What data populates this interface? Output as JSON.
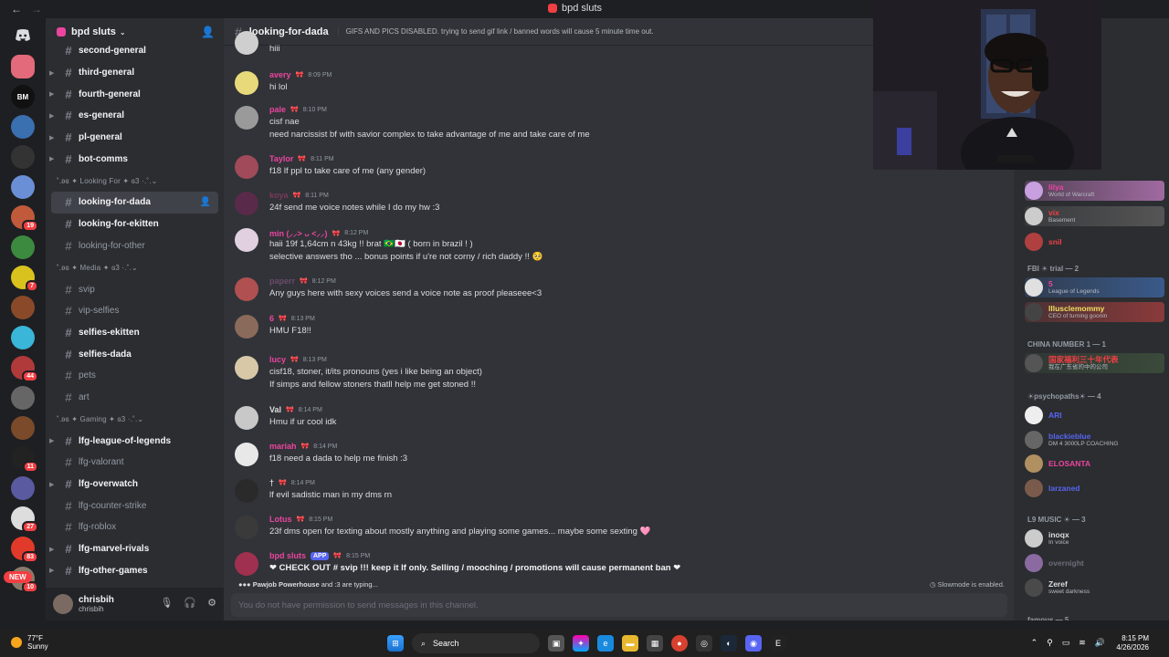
{
  "window": {
    "title": "bpd sluts",
    "back_icon": "←",
    "forward_icon": "→"
  },
  "servers": {
    "items": [
      {
        "color": "#e26a7a",
        "badge": ""
      },
      {
        "color": "#111111",
        "label": "BM",
        "badge": ""
      },
      {
        "color": "#3a6fb0",
        "badge": ""
      },
      {
        "color": "#333333",
        "badge": ""
      },
      {
        "color": "#6b8fd6",
        "badge": ""
      },
      {
        "color": "#c05a3a",
        "badge": "19"
      },
      {
        "color": "#3c8a40",
        "badge": ""
      },
      {
        "color": "#d9c21e",
        "badge": "7"
      },
      {
        "color": "#8a4a2a",
        "badge": ""
      },
      {
        "color": "#39b6d8",
        "badge": ""
      },
      {
        "color": "#b03a3a",
        "badge": "44"
      },
      {
        "color": "#666666",
        "badge": ""
      },
      {
        "color": "#7a4a2a",
        "badge": ""
      },
      {
        "color": "#222222",
        "badge": "11"
      },
      {
        "color": "#5a5aa0",
        "badge": ""
      },
      {
        "color": "#dddddd",
        "badge": "27"
      },
      {
        "color": "#e23a2a",
        "badge": "83"
      },
      {
        "color": "#8a7a6a",
        "badge": "10"
      }
    ],
    "new_label": "NEW"
  },
  "guild": {
    "name": "bpd sluts"
  },
  "channels": [
    {
      "type": "channel",
      "name": "second-general",
      "style": "bold",
      "caret": false
    },
    {
      "type": "channel",
      "name": "third-general",
      "style": "bold",
      "caret": true
    },
    {
      "type": "channel",
      "name": "fourth-general",
      "style": "bold",
      "caret": true
    },
    {
      "type": "channel",
      "name": "es-general",
      "style": "bold",
      "caret": true
    },
    {
      "type": "channel",
      "name": "pl-general",
      "style": "bold",
      "caret": true
    },
    {
      "type": "channel",
      "name": "bot-comms",
      "style": "bold",
      "caret": true
    },
    {
      "type": "category",
      "name": "˚.ʚɞ ✦ Looking For ✦ ɞ3 ·.˚."
    },
    {
      "type": "channel",
      "name": "looking-for-dada",
      "style": "active",
      "caret": false
    },
    {
      "type": "channel",
      "name": "looking-for-ekitten",
      "style": "bold",
      "caret": false
    },
    {
      "type": "channel",
      "name": "looking-for-other",
      "style": "dim",
      "caret": false
    },
    {
      "type": "category",
      "name": "˚.ʚɞ ✦ Media ✦ ɞ3 ·.˚."
    },
    {
      "type": "channel",
      "name": "svip",
      "style": "dim",
      "caret": false
    },
    {
      "type": "channel",
      "name": "vip-selfies",
      "style": "dim",
      "caret": false
    },
    {
      "type": "channel",
      "name": "selfies-ekitten",
      "style": "bold",
      "caret": false
    },
    {
      "type": "channel",
      "name": "selfies-dada",
      "style": "bold",
      "caret": false
    },
    {
      "type": "channel",
      "name": "pets",
      "style": "dim",
      "caret": false
    },
    {
      "type": "channel",
      "name": "art",
      "style": "dim",
      "caret": false
    },
    {
      "type": "category",
      "name": "˚.ʚɞ ✦ Gaming ✦ ɞ3 ·.˚."
    },
    {
      "type": "channel",
      "name": "lfg-league-of-legends",
      "style": "bold",
      "caret": true
    },
    {
      "type": "channel",
      "name": "lfg-valorant",
      "style": "dim",
      "caret": false
    },
    {
      "type": "channel",
      "name": "lfg-overwatch",
      "style": "bold",
      "caret": true
    },
    {
      "type": "channel",
      "name": "lfg-counter-strike",
      "style": "dim",
      "caret": false
    },
    {
      "type": "channel",
      "name": "lfg-roblox",
      "style": "dim",
      "caret": false
    },
    {
      "type": "channel",
      "name": "lfg-marvel-rivals",
      "style": "bold",
      "caret": true
    },
    {
      "type": "channel",
      "name": "lfg-other-games",
      "style": "bold",
      "caret": true
    }
  ],
  "user": {
    "name": "chrisbih",
    "tag": "chrisbih"
  },
  "channel_header": {
    "name": "looking-for-dada",
    "topic": "GIFS AND PICS DISABLED. trying to send gif link / banned words will cause 5 minute time out."
  },
  "messages": [
    {
      "author": "",
      "color": "#dbdee1",
      "time": "",
      "lines": [
        "hiii"
      ],
      "avatar": "#cfcfcf"
    },
    {
      "author": "avery",
      "color": "#eb459f",
      "time": "8:09 PM",
      "lines": [
        "hi lol"
      ],
      "avatar": "#e8d97a"
    },
    {
      "author": "pale",
      "color": "#eb459f",
      "time": "8:10 PM",
      "lines": [
        "cisf nae",
        "need narcissist bf with savior complex to take advantage of me and take care of me"
      ],
      "avatar": "#9a9a9a"
    },
    {
      "author": "Taylor",
      "color": "#eb459f",
      "time": "8:11 PM",
      "lines": [
        "f18 lf ppl to take care of me (any gender)"
      ],
      "avatar": "#a04a5a"
    },
    {
      "author": "koya",
      "color": "#7a3a5a",
      "time": "8:11 PM",
      "lines": [
        "24f send me voice notes while I do my hw :3"
      ],
      "avatar": "#5a2a4a"
    },
    {
      "author": "min (⸝⸝> ᴗ <⸝⸝)",
      "color": "#eb459f",
      "time": "8:12 PM",
      "lines": [
        "haii 19f 1,64cm n 43kg !! brat 🇧🇷🇯🇵 ( born in brazil ! )",
        "selective answers tho ... bonus points if u're not corny / rich daddy !! 🥺"
      ],
      "avatar": "#e0d0e0"
    },
    {
      "author": "paperr",
      "color": "#6a4a6a",
      "time": "8:12 PM",
      "lines": [
        "Any guys here with sexy voices send a voice note as proof pleaseee<3"
      ],
      "avatar": "#b05050"
    },
    {
      "author": "6",
      "color": "#eb459f",
      "time": "8:13 PM",
      "lines": [
        "HMU F18!!"
      ],
      "avatar": "#8a6a5a"
    },
    {
      "author": "lucy",
      "color": "#eb459f",
      "time": "8:13 PM",
      "lines": [
        "cisf18, stoner, it/its pronouns (yes i like being an object)",
        "If simps and fellow stoners thatll help me get stoned !!"
      ],
      "avatar": "#d8c8a8"
    },
    {
      "author": "Val",
      "color": "#dbdee1",
      "time": "8:14 PM",
      "lines": [
        "Hmu if ur cool idk"
      ],
      "avatar": "#c8c8c8"
    },
    {
      "author": "mariah",
      "color": "#eb459f",
      "time": "8:14 PM",
      "lines": [
        "f18 need a dada to help me finish :3"
      ],
      "avatar": "#e8e8e8"
    },
    {
      "author": "†",
      "color": "#dbdee1",
      "time": "8:14 PM",
      "lines": [
        "lf evil sadistic man in my dms rn"
      ],
      "avatar": "#2a2a2a"
    },
    {
      "author": "Lotus",
      "color": "#eb459f",
      "time": "8:15 PM",
      "lines": [
        "23f dms open for texting about mostly anything and playing some games... maybe some sexting 🩷"
      ],
      "avatar": "#3a3a3a"
    },
    {
      "author": "bpd sluts",
      "color": "#eb459f",
      "time": "8:15 PM",
      "app": "APP",
      "lines": [
        "❤ CHECK OUT # svip !!! keep it lf only. Selling / mooching / promotions will cause permanent ban ❤"
      ],
      "avatar": "#a03050"
    }
  ],
  "typing": {
    "who": "Pawjob Powerhouse",
    "rest": "and :3 are typing..."
  },
  "slowmode": "Slowmode is enabled.",
  "composer_placeholder": "You do not have permission to send messages in this channel.",
  "member_groups": [
    {
      "title": "",
      "members": [
        {
          "name": "lilya",
          "status": "World of Warcraft",
          "color": "#eb459f",
          "bg": "#a06aa0",
          "avatar": "#c8a0e0"
        },
        {
          "name": "vix",
          "status": "Basement",
          "color": "#f23f43",
          "bg": "#555555",
          "avatar": "#cccccc"
        },
        {
          "name": "snil",
          "status": "",
          "color": "#f23f43",
          "bg": "",
          "avatar": "#b04040"
        }
      ]
    },
    {
      "title": "FBI ☀ trial — 2",
      "members": [
        {
          "name": "5",
          "status": "League of Legends",
          "color": "#eb459f",
          "bg": "#3a5a8a",
          "avatar": "#e0e0e0"
        },
        {
          "name": "lllusclemommy",
          "status": "CEO of turning goonin",
          "color": "#f0e060",
          "bg": "#8a3a3a",
          "avatar": "#444444"
        }
      ]
    },
    {
      "title": "CHINA NUMBER 1 — 1",
      "members": [
        {
          "name": "国家福利三十年代表",
          "status": "我在广东省的中的公司",
          "color": "#f23f43",
          "bg": "#3a4a3a",
          "avatar": "#555555"
        }
      ]
    },
    {
      "title": "☀psychopaths☀ — 4",
      "members": [
        {
          "name": "ARI",
          "status": "",
          "color": "#5865f2",
          "bg": "",
          "avatar": "#eeeeee"
        },
        {
          "name": "blackieblue",
          "status": "DM 4 3000LP COACHING",
          "color": "#5865f2",
          "bg": "",
          "avatar": "#666666"
        },
        {
          "name": "ELOSANTA",
          "status": "",
          "color": "#eb459f",
          "bg": "",
          "avatar": "#b09060"
        },
        {
          "name": "larzaned",
          "status": "",
          "color": "#5865f2",
          "bg": "",
          "avatar": "#7a5a4a"
        }
      ]
    },
    {
      "title": "L9 MUSIC ☀ — 3",
      "members": [
        {
          "name": "inoqx",
          "status": "In voice",
          "color": "#dbdee1",
          "bg": "",
          "avatar": "#cccccc"
        },
        {
          "name": "overnight",
          "status": "",
          "color": "#6d6f78",
          "bg": "",
          "avatar": "#8a6aa0"
        },
        {
          "name": "Zeref",
          "status": "sweet darkness",
          "color": "#dbdee1",
          "bg": "",
          "avatar": "#4a4a4a"
        }
      ]
    },
    {
      "title": "famous — 5",
      "members": []
    }
  ],
  "taskbar": {
    "temp": "77°F",
    "condition": "Sunny",
    "search_label": "Search",
    "time": "8:15 PM",
    "date": "4/26/2026"
  },
  "colors": {
    "bg": "#313338",
    "sidebar": "#2b2d31",
    "rail": "#1e1f22",
    "accent": "#5865f2",
    "pink": "#eb459f"
  }
}
